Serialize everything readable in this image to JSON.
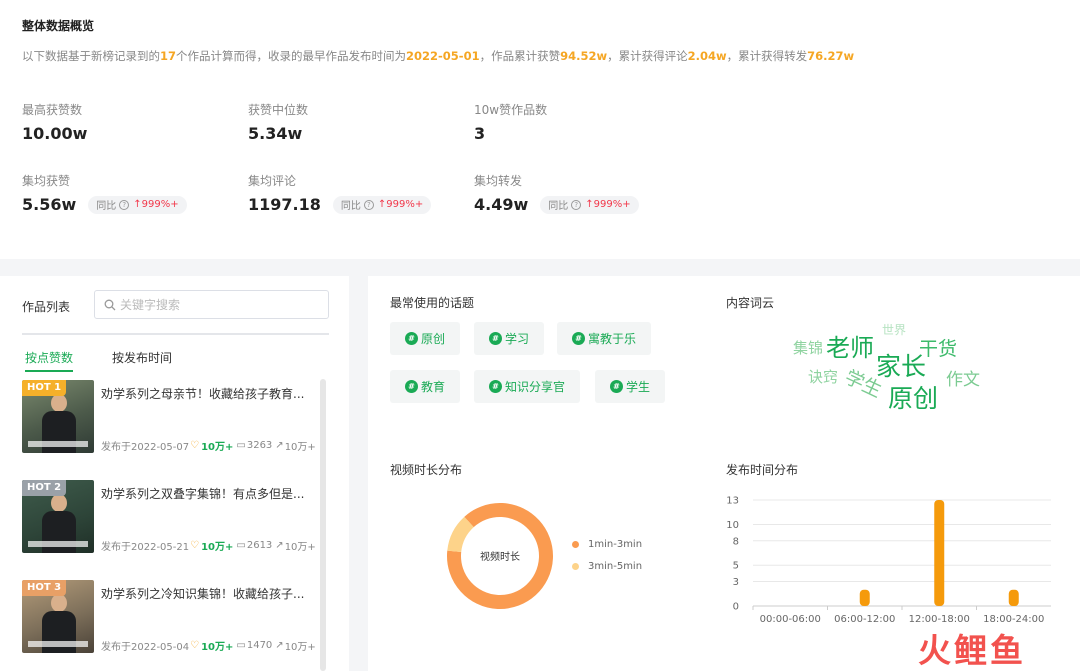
{
  "overview": {
    "title": "整体数据概览",
    "desc": {
      "p1": "以下数据基于新榜记录到的",
      "count": "17",
      "p2": "个作品计算而得，收录的最早作品发布时间为",
      "date": "2022-05-01",
      "p3": "，作品累计获赞",
      "likes": "94.52w",
      "p4": "，累计获得评论",
      "comments": "2.04w",
      "p5": "，累计获得转发",
      "shares": "76.27w"
    },
    "metrics": [
      {
        "label": "最高获赞数",
        "value": "10.00w"
      },
      {
        "label": "获赞中位数",
        "value": "5.34w"
      },
      {
        "label": "10w赞作品数",
        "value": "3"
      },
      {
        "label": "集均获赞",
        "value": "5.56w",
        "yoy_label": "同比",
        "yoy_value": "999%+"
      },
      {
        "label": "集均评论",
        "value": "1197.18",
        "yoy_label": "同比",
        "yoy_value": "999%+"
      },
      {
        "label": "集均转发",
        "value": "4.49w",
        "yoy_label": "同比",
        "yoy_value": "999%+"
      }
    ]
  },
  "works": {
    "title": "作品列表",
    "search_placeholder": "关键字搜索",
    "tabs": [
      "按点赞数",
      "按发布时间"
    ],
    "items": [
      {
        "hot": "HOT 1",
        "title": "劝学系列之母亲节！收藏给孩子教育...",
        "date": "发布于2022-05-07",
        "likes": "10万+",
        "comments": "3263",
        "shares": "10万+"
      },
      {
        "hot": "HOT 2",
        "title": "劝学系列之双叠字集锦！有点多但是...",
        "date": "发布于2022-05-21",
        "likes": "10万+",
        "comments": "2613",
        "shares": "10万+"
      },
      {
        "hot": "HOT 3",
        "title": "劝学系列之冷知识集锦！收藏给孩子...",
        "date": "发布于2022-05-04",
        "likes": "10万+",
        "comments": "1470",
        "shares": "10万+"
      }
    ]
  },
  "topics": {
    "title": "最常使用的话题",
    "items": [
      "原创",
      "学习",
      "寓教于乐",
      "教育",
      "知识分享官",
      "学生"
    ]
  },
  "cloud": {
    "title": "内容词云",
    "words": [
      {
        "text": "世界",
        "color": "#b7e3c2"
      },
      {
        "text": "集锦",
        "color": "#8fd3a0"
      },
      {
        "text": "老师",
        "color": "#1aaa55"
      },
      {
        "text": "干货",
        "color": "#3cba6a"
      },
      {
        "text": "家长",
        "color": "#1aaa55"
      },
      {
        "text": "诀窍",
        "color": "#8fd3a0"
      },
      {
        "text": "学生",
        "color": "#7ccb92"
      },
      {
        "text": "原创",
        "color": "#1aaa55"
      },
      {
        "text": "作文",
        "color": "#7ccb92"
      }
    ]
  },
  "donut": {
    "title": "视频时长分布",
    "center_label": "视频时长",
    "slices": [
      {
        "name": "1min-3min",
        "value": 15,
        "color": "#fa9b50"
      },
      {
        "name": "3min-5min",
        "value": 2,
        "color": "#fdd38a"
      }
    ]
  },
  "chart_data": {
    "type": "bar",
    "title": "发布时间分布",
    "categories": [
      "00:00-06:00",
      "06:00-12:00",
      "12:00-18:00",
      "18:00-24:00"
    ],
    "values": [
      0,
      2,
      13,
      2
    ],
    "yticks": [
      0,
      3,
      5,
      8,
      10,
      13
    ],
    "ylim": [
      0,
      13
    ],
    "color": "#f59a0b",
    "grid": true
  },
  "watermark": "火鲤鱼"
}
